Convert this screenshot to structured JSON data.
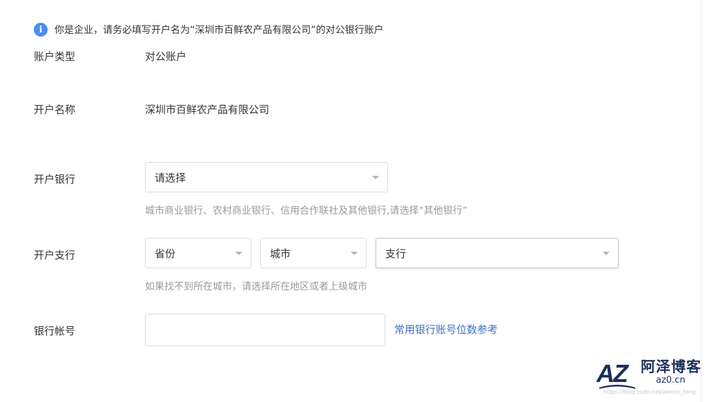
{
  "notice": {
    "icon": "info-icon",
    "text": "你是企业，请务必填写开户名为“深圳市百鲜农产品有限公司”的对公银行账户"
  },
  "account_type": {
    "label": "账户类型",
    "value": "对公账户"
  },
  "account_name": {
    "label": "开户名称",
    "value": "深圳市百鲜农产品有限公司"
  },
  "bank": {
    "label": "开户银行",
    "select_value": "请选择",
    "hint": "城市商业银行、农村商业银行、信用合作联社及其他银行,请选择“其他银行”"
  },
  "branch": {
    "label": "开户支行",
    "province": "省份",
    "city": "城市",
    "branch": "支行",
    "hint": "如果找不到所在城市，请选择所在地区或者上级城市"
  },
  "account_number": {
    "label": "银行帐号",
    "value": "",
    "link": "常用银行账号位数参考"
  },
  "logo": {
    "title": "阿泽博客",
    "domain": "az0.cn",
    "mark": "AZ"
  },
  "watermark": "https://blog.csdn.net/weixin_tong"
}
